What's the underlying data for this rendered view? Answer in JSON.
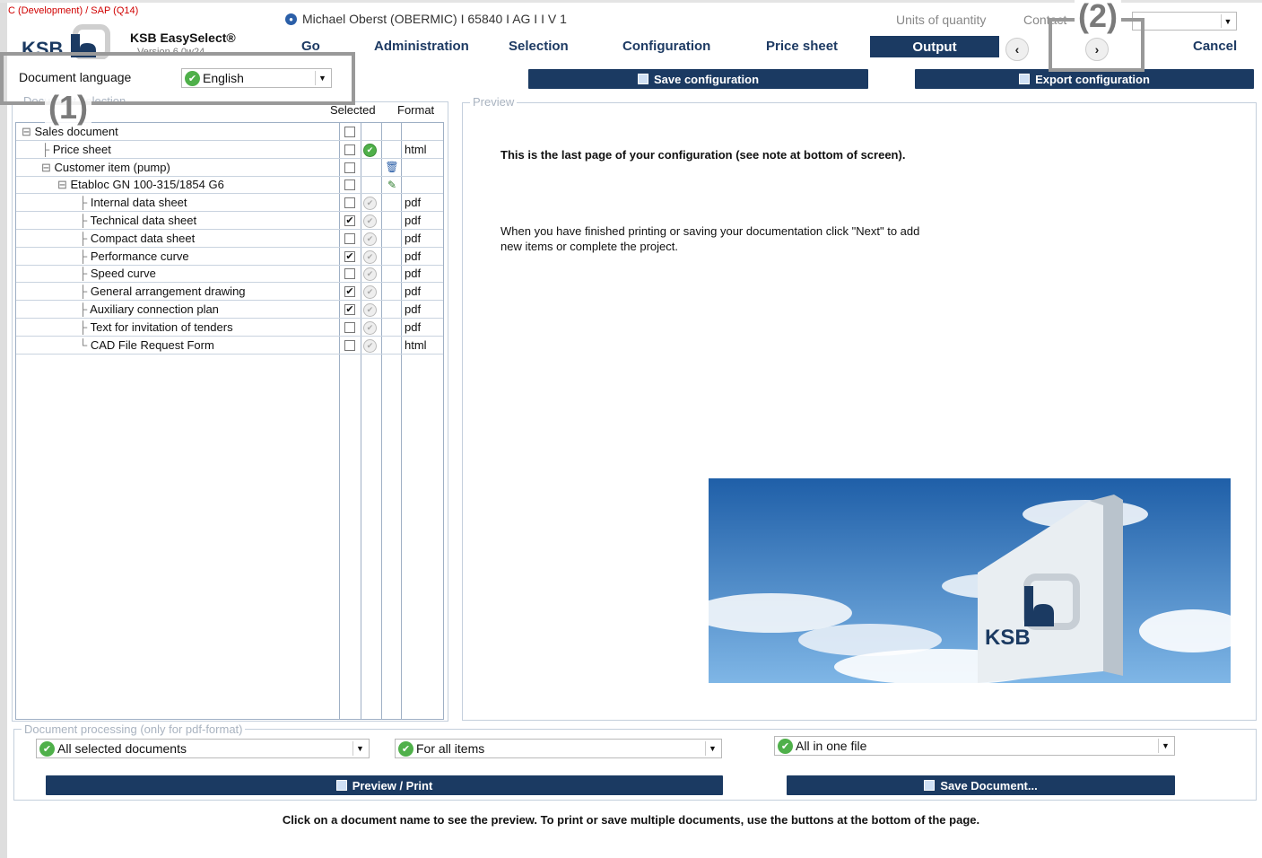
{
  "header": {
    "environment": "C (Development) / SAP (Q14)",
    "app_name": "KSB EasySelect®",
    "app_version": "Version 6.0w24",
    "user_info": "Michael Oberst (OBERMIC)  I  65840  I  AG  I    I   V  1",
    "units_label": "Units of quantity",
    "contact_label": "Contact"
  },
  "nav": {
    "go": "Go",
    "administration": "Administration",
    "selection": "Selection",
    "configuration": "Configuration",
    "price_sheet": "Price sheet",
    "output": "Output",
    "cancel": "Cancel",
    "prev_icon": "‹",
    "next_icon": "›"
  },
  "annotations": {
    "one": "(1)",
    "two": "(2)"
  },
  "language": {
    "label": "Document language",
    "value": "English"
  },
  "buttons": {
    "save_configuration": "Save configuration",
    "export_configuration": "Export configuration",
    "preview_print": "Preview / Print",
    "save_document": "Save Document..."
  },
  "document_selection": {
    "legend": "Document selection",
    "col_selected": "Selected",
    "col_format": "Format",
    "rows": [
      {
        "name": "Sales document",
        "checked": false,
        "status": "",
        "format": "",
        "tool": ""
      },
      {
        "name": "Price sheet",
        "checked": false,
        "status": "ok",
        "format": "html",
        "tool": ""
      },
      {
        "name": "Customer item (pump)",
        "checked": false,
        "status": "",
        "format": "",
        "tool": "trash-icon"
      },
      {
        "name": "Etabloc GN 100-315/1854 G6",
        "checked": false,
        "status": "",
        "format": "",
        "tool": "edit-icon"
      },
      {
        "name": "Internal data sheet",
        "checked": false,
        "status": "grey",
        "format": "pdf",
        "tool": ""
      },
      {
        "name": "Technical data sheet",
        "checked": true,
        "status": "grey",
        "format": "pdf",
        "tool": ""
      },
      {
        "name": "Compact data sheet",
        "checked": false,
        "status": "grey",
        "format": "pdf",
        "tool": ""
      },
      {
        "name": "Performance curve",
        "checked": true,
        "status": "grey",
        "format": "pdf",
        "tool": ""
      },
      {
        "name": "Speed curve",
        "checked": false,
        "status": "grey",
        "format": "pdf",
        "tool": ""
      },
      {
        "name": "General arrangement drawing",
        "checked": true,
        "status": "grey",
        "format": "pdf",
        "tool": ""
      },
      {
        "name": "Auxiliary connection plan",
        "checked": true,
        "status": "grey",
        "format": "pdf",
        "tool": ""
      },
      {
        "name": "Text for invitation of tenders",
        "checked": false,
        "status": "grey",
        "format": "pdf",
        "tool": ""
      },
      {
        "name": "CAD File Request Form",
        "checked": false,
        "status": "grey",
        "format": "html",
        "tool": ""
      }
    ]
  },
  "preview": {
    "legend": "Preview",
    "heading": "This is the last page of your configuration (see note at bottom of screen).",
    "body": "When you have finished printing or saving your documentation click \"Next\" to add new items or complete the project.",
    "image_logo_text": "KSB"
  },
  "processing": {
    "legend": "Document processing (only for pdf-format)",
    "documents": "All selected documents",
    "items": "For all items",
    "files": "All in one file"
  },
  "footer": "Click on a document name to see the preview. To print or save multiple documents, use the buttons at the bottom of the page.",
  "colors": {
    "navy": "#1b3a62",
    "accent_green": "#4fb04a",
    "env_red": "#d00000"
  }
}
